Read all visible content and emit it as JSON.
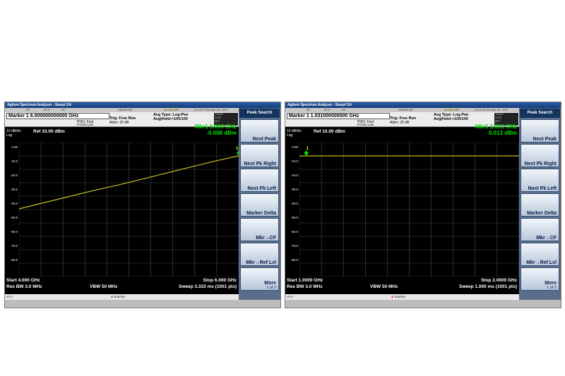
{
  "panels": [
    {
      "title": "Agilent Spectrum Analyzer - Swept SA",
      "toolbar": {
        "rf": "RF",
        "fifty": "50 Ω",
        "dc": "DC",
        "sense": "SENSE:INT",
        "align": "ALIGN OFF",
        "datetime": "01:15:37 PM Mar 30, 2023"
      },
      "marker_label": "Marker 1 6.000000000000 GHz",
      "pno": "PNO: Fast",
      "ifgain": "IFGain:Low",
      "trig": "Trig: Free Run",
      "atten": "Atten: 20 dB",
      "avg_type": "Avg Type: Log-Pwr",
      "avg_hold": "Avg|Hold:>100/100",
      "trace_lines": [
        "TRACE",
        "TYPE",
        "DET"
      ],
      "scale": "10 dB/div",
      "log": "Log",
      "ref": "Ref 10.00 dBm",
      "mkr_freq": "Mkr1 6.000 GHz",
      "mkr_amp": "-0.008 dBm",
      "marker_num": "1",
      "y_labels": [
        "0.00",
        "-10.0",
        "-20.0",
        "-30.0",
        "-40.0",
        "-50.0",
        "-60.0",
        "-70.0",
        "-80.0"
      ],
      "start": "Start 4.000 GHz",
      "res_bw": "Res BW 3.0 MHz",
      "vbw": "VBW 50 MHz",
      "stop": "Stop 6.000 GHz",
      "sweep": "Sweep  3.333 ms (1001 pts)",
      "msg": "MSG",
      "status": "STATUS",
      "softkey_title": "Peak Search",
      "softkeys": [
        "Next Peak",
        "Next Pk Right",
        "Next Pk Left",
        "Marker Delta",
        "Mkr→CF",
        "Mkr→Ref Lvl"
      ],
      "more": "More",
      "more_page": "1 of 2",
      "trace_color": "#c8c020",
      "trace_y_dbm": [
        -39.5,
        -35,
        -30.5,
        -26,
        -22,
        -17.5,
        -13,
        -8.5,
        -4,
        0.0
      ],
      "marker_x_frac": 1.0
    },
    {
      "title": "Agilent Spectrum Analyzer - Swept SA",
      "toolbar": {
        "rf": "RF",
        "fifty": "50 Ω",
        "dc": "DC",
        "sense": "SENSE:INT",
        "align": "ALIGN OFF",
        "datetime": "01:20:45 PM Mar 30, 2023"
      },
      "marker_label": "Marker 1 1.031000000000 GHz",
      "pno": "PNO: Fast",
      "ifgain": "IFGain:Low",
      "trig": "Trig: Free Run",
      "atten": "Atten: 20 dB",
      "avg_type": "Avg Type: Log-Pwr",
      "avg_hold": "Avg|Hold:>100/100",
      "trace_lines": [
        "TRACE",
        "TYPE",
        "DET"
      ],
      "scale": "10 dB/div",
      "log": "Log",
      "ref": "Ref 10.00 dBm",
      "mkr_freq": "Mkr1 1.031 GHz",
      "mkr_amp": "0.013 dBm",
      "marker_num": "1",
      "y_labels": [
        "0.00",
        "-10.0",
        "-20.0",
        "-30.0",
        "-40.0",
        "-50.0",
        "-60.0",
        "-70.0",
        "-80.0"
      ],
      "start": "Start 1.0000 GHz",
      "res_bw": "Res BW 3.0 MHz",
      "vbw": "VBW 50 MHz",
      "stop": "Stop 2.0000 GHz",
      "sweep": "Sweep  1.000 ms (1001 pts)",
      "msg": "MSG",
      "status": "STATUS",
      "softkey_title": "Peak Search",
      "softkeys": [
        "Next Peak",
        "Next Pk Right",
        "Next Pk Left",
        "Marker Delta",
        "Mkr→CF",
        "Mkr→Ref Lvl"
      ],
      "more": "More",
      "more_page": "1 of 2",
      "trace_color": "#c8c020",
      "trace_y_dbm": [
        0.0,
        0.0,
        0.0,
        0.0,
        0.0,
        0.0,
        0.0,
        0.0,
        0.0,
        0.0
      ],
      "marker_x_frac": 0.031
    }
  ]
}
